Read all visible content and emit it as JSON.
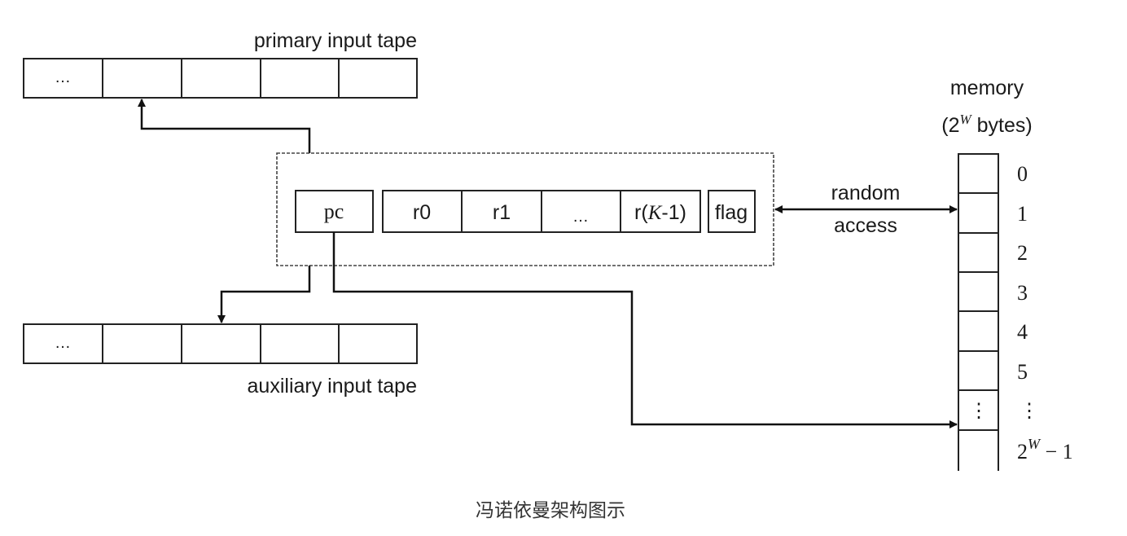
{
  "diagram": {
    "primary_tape": {
      "label": "primary input tape",
      "cells": [
        "…",
        "",
        "",
        "",
        ""
      ]
    },
    "auxiliary_tape": {
      "label": "auxiliary input tape",
      "cells": [
        "…",
        "",
        "",
        "",
        ""
      ]
    },
    "cpu": {
      "pc_label": "pc",
      "registers": [
        "r0",
        "r1",
        "…",
        "r(K-1)"
      ],
      "register_last_parts": {
        "prefix": "r(",
        "var": "K",
        "suffix": "-1)"
      },
      "flag_label": "flag"
    },
    "link": {
      "line1": "random",
      "line2": "access"
    },
    "memory": {
      "title": "memory",
      "size_prefix": "(2",
      "size_exp": "W",
      "size_suffix": " bytes)",
      "addresses": [
        "0",
        "1",
        "2",
        "3",
        "4",
        "5",
        "⋮"
      ],
      "cell_ellipsis": "⋮",
      "last_address_base": "2",
      "last_address_exp": "W",
      "last_address_suffix": " − 1"
    },
    "caption": "冯诺依曼架构图示"
  }
}
